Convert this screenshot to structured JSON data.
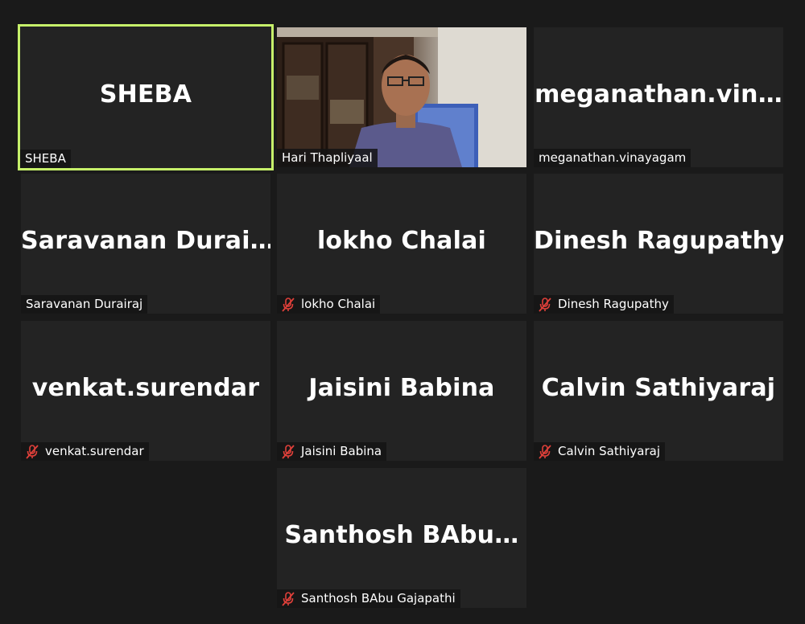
{
  "participants": [
    {
      "display": "SHEBA",
      "label": "SHEBA",
      "muted": false,
      "active": true,
      "video": false
    },
    {
      "display": "",
      "label": "Hari Thapliyaal",
      "muted": false,
      "active": false,
      "video": true
    },
    {
      "display": "meganathan.vin…",
      "label": "meganathan.vinayagam",
      "muted": false,
      "active": false,
      "video": false
    },
    {
      "display": "Saravanan  Durai…",
      "label": "Saravanan Durairaj",
      "muted": false,
      "active": false,
      "video": false
    },
    {
      "display": "lokho Chalai",
      "label": "lokho Chalai",
      "muted": true,
      "active": false,
      "video": false
    },
    {
      "display": "Dinesh Ragupathy",
      "label": "Dinesh Ragupathy",
      "muted": true,
      "active": false,
      "video": false
    },
    {
      "display": "venkat.surendar",
      "label": "venkat.surendar",
      "muted": true,
      "active": false,
      "video": false
    },
    {
      "display": "Jaisini Babina",
      "label": "Jaisini Babina",
      "muted": true,
      "active": false,
      "video": false
    },
    {
      "display": "Calvin Sathiyaraj",
      "label": "Calvin Sathiyaraj",
      "muted": true,
      "active": false,
      "video": false
    },
    {
      "display": "Santhosh  BAbu…",
      "label": "Santhosh BAbu Gajapathi",
      "muted": true,
      "active": false,
      "video": false
    }
  ],
  "colors": {
    "active_border": "#c6f06a",
    "muted_icon": "#e0403a",
    "tile_bg": "#232323"
  },
  "icons": {
    "muted": "microphone-muted-icon"
  }
}
